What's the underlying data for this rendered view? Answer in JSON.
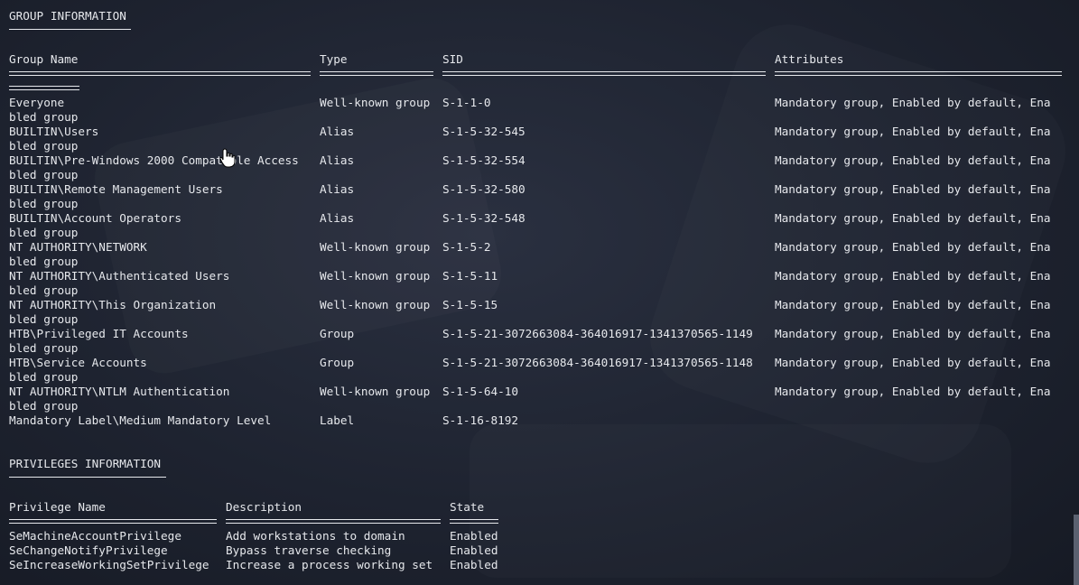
{
  "group_section": {
    "title": "GROUP INFORMATION",
    "headers": [
      "Group Name",
      "Type",
      "SID",
      "Attributes"
    ],
    "rows": [
      {
        "name": "Everyone",
        "type": "Well-known group",
        "sid": "S-1-1-0",
        "attr": "Mandatory group, Enabled by default, Ena",
        "wrap": "bled group"
      },
      {
        "name": "BUILTIN\\Users",
        "type": "Alias",
        "sid": "S-1-5-32-545",
        "attr": "Mandatory group, Enabled by default, Ena",
        "wrap": "bled group"
      },
      {
        "name": "BUILTIN\\Pre-Windows 2000 Compatible Access",
        "type": "Alias",
        "sid": "S-1-5-32-554",
        "attr": "Mandatory group, Enabled by default, Ena",
        "wrap": "bled group"
      },
      {
        "name": "BUILTIN\\Remote Management Users",
        "type": "Alias",
        "sid": "S-1-5-32-580",
        "attr": "Mandatory group, Enabled by default, Ena",
        "wrap": "bled group"
      },
      {
        "name": "BUILTIN\\Account Operators",
        "type": "Alias",
        "sid": "S-1-5-32-548",
        "attr": "Mandatory group, Enabled by default, Ena",
        "wrap": "bled group"
      },
      {
        "name": "NT AUTHORITY\\NETWORK",
        "type": "Well-known group",
        "sid": "S-1-5-2",
        "attr": "Mandatory group, Enabled by default, Ena",
        "wrap": "bled group"
      },
      {
        "name": "NT AUTHORITY\\Authenticated Users",
        "type": "Well-known group",
        "sid": "S-1-5-11",
        "attr": "Mandatory group, Enabled by default, Ena",
        "wrap": "bled group"
      },
      {
        "name": "NT AUTHORITY\\This Organization",
        "type": "Well-known group",
        "sid": "S-1-5-15",
        "attr": "Mandatory group, Enabled by default, Ena",
        "wrap": "bled group"
      },
      {
        "name": "HTB\\Privileged IT Accounts",
        "type": "Group",
        "sid": "S-1-5-21-3072663084-364016917-1341370565-1149",
        "attr": "Mandatory group, Enabled by default, Ena",
        "wrap": "bled group"
      },
      {
        "name": "HTB\\Service Accounts",
        "type": "Group",
        "sid": "S-1-5-21-3072663084-364016917-1341370565-1148",
        "attr": "Mandatory group, Enabled by default, Ena",
        "wrap": "bled group"
      },
      {
        "name": "NT AUTHORITY\\NTLM Authentication",
        "type": "Well-known group",
        "sid": "S-1-5-64-10",
        "attr": "Mandatory group, Enabled by default, Ena",
        "wrap": "bled group"
      },
      {
        "name": "Mandatory Label\\Medium Mandatory Level",
        "type": "Label",
        "sid": "S-1-16-8192",
        "attr": "",
        "wrap": ""
      }
    ]
  },
  "privileges_section": {
    "title": "PRIVILEGES INFORMATION",
    "headers": [
      "Privilege Name",
      "Description",
      "State"
    ],
    "rows": [
      {
        "name": "SeMachineAccountPrivilege",
        "desc": "Add workstations to domain",
        "state": "Enabled"
      },
      {
        "name": "SeChangeNotifyPrivilege",
        "desc": "Bypass traverse checking",
        "state": "Enabled"
      },
      {
        "name": "SeIncreaseWorkingSetPrivilege",
        "desc": "Increase a process working set",
        "state": "Enabled"
      }
    ]
  }
}
